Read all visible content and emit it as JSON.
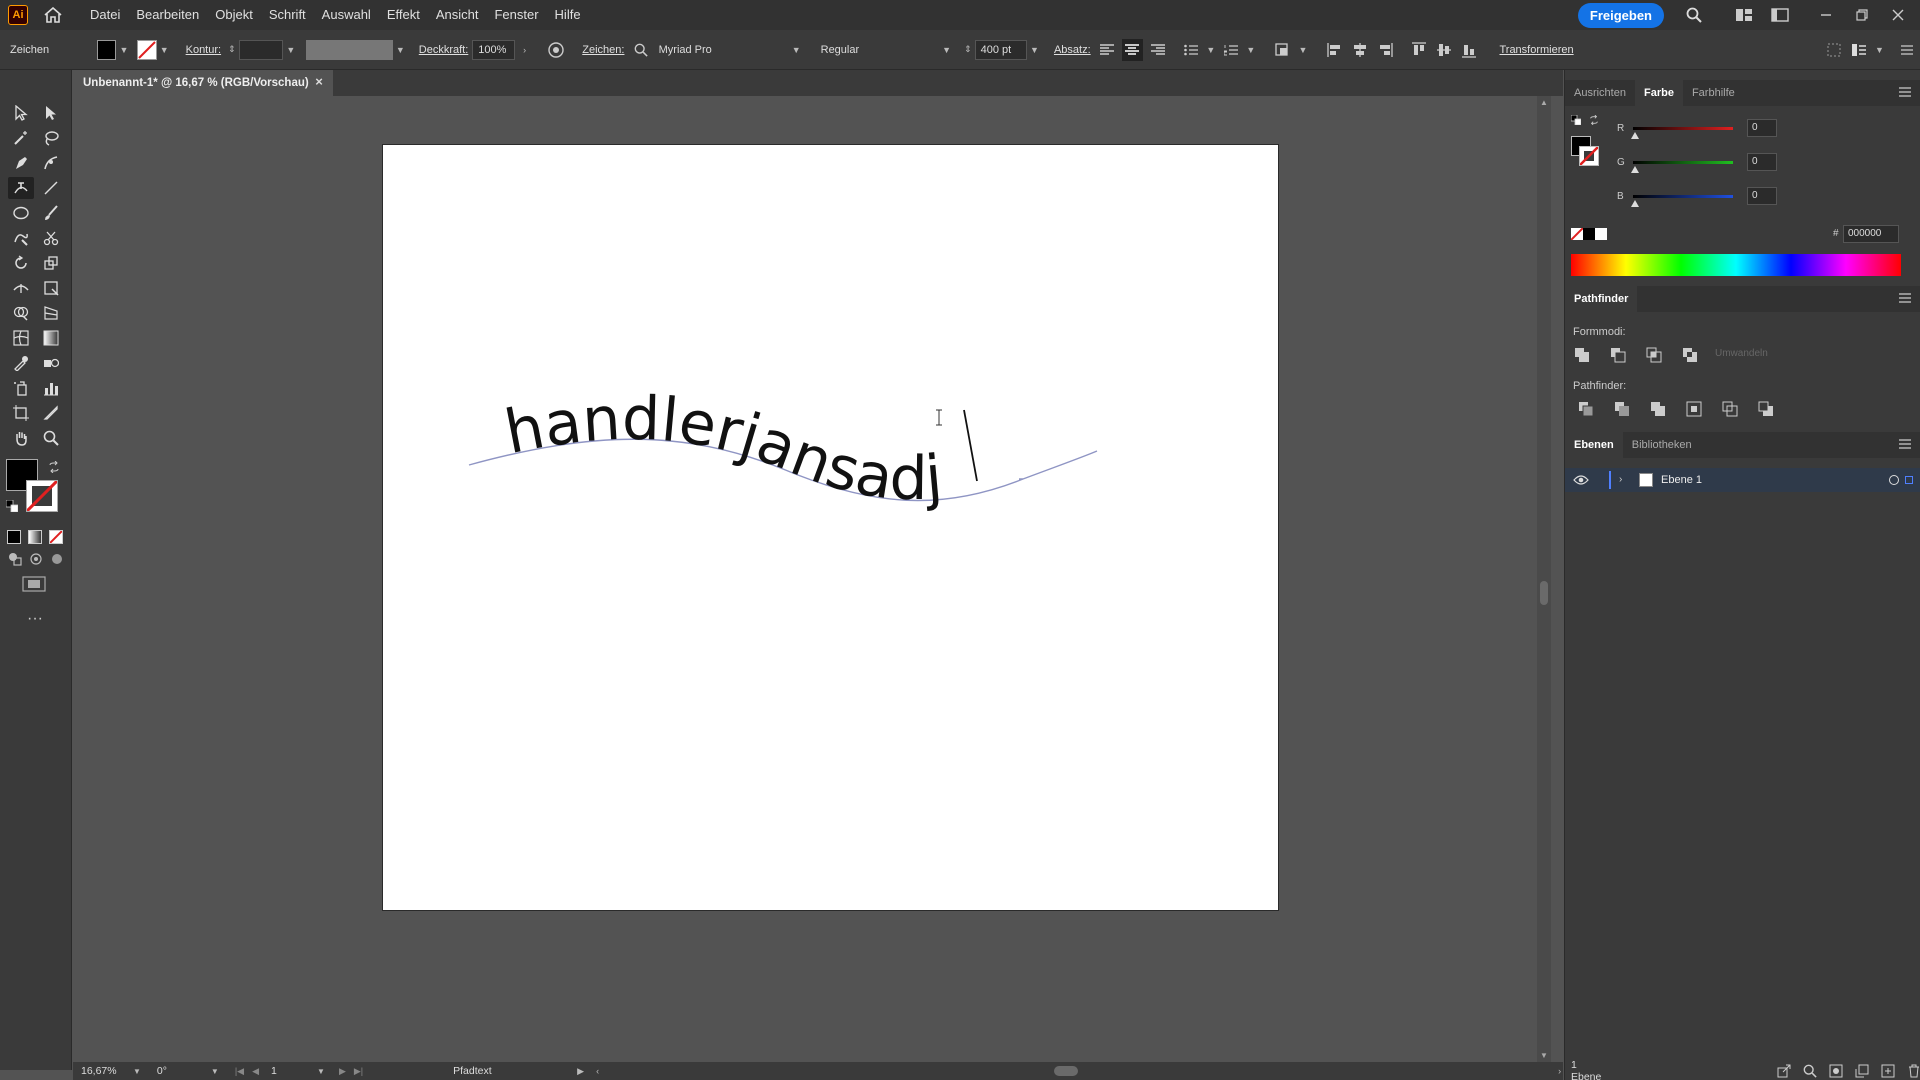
{
  "app": {
    "logo_text": "Ai",
    "menu": [
      "Datei",
      "Bearbeiten",
      "Objekt",
      "Schrift",
      "Auswahl",
      "Effekt",
      "Ansicht",
      "Fenster",
      "Hilfe"
    ],
    "share_label": "Freigeben"
  },
  "control_bar": {
    "mode_label": "Zeichen",
    "stroke_label": "Kontur:",
    "opacity_label": "Deckkraft:",
    "opacity_value": "100%",
    "char_label": "Zeichen:",
    "font_family": "Myriad Pro",
    "font_style": "Regular",
    "font_size": "400 pt",
    "paragraph_label": "Absatz:",
    "transform_label": "Transformieren"
  },
  "document": {
    "tab_title": "Unbenannt-1* @ 16,67 % (RGB/Vorschau)",
    "path_text": "handlerjansadj"
  },
  "status_bar": {
    "zoom": "16,67%",
    "rotation": "0°",
    "artboard_number": "1",
    "selection_info": "Pfadtext"
  },
  "color_panel": {
    "tabs": [
      "Ausrichten",
      "Farbe",
      "Farbhilfe"
    ],
    "active_tab": "Farbe",
    "channels": [
      {
        "letter": "R",
        "value": "0",
        "color": "#e02020"
      },
      {
        "letter": "G",
        "value": "0",
        "color": "#20c020"
      },
      {
        "letter": "B",
        "value": "0",
        "color": "#2050e0"
      }
    ],
    "hex_label": "#",
    "hex_value": "000000"
  },
  "pathfinder_panel": {
    "title": "Pathfinder",
    "shape_modes_label": "Formmodi:",
    "expand_label": "Umwandeln",
    "pathfinders_label": "Pathfinder:"
  },
  "layers_panel": {
    "tabs": [
      "Ebenen",
      "Bibliotheken"
    ],
    "active_tab": "Ebenen",
    "layer_name": "Ebene 1",
    "layer_count": "1 Ebene"
  }
}
